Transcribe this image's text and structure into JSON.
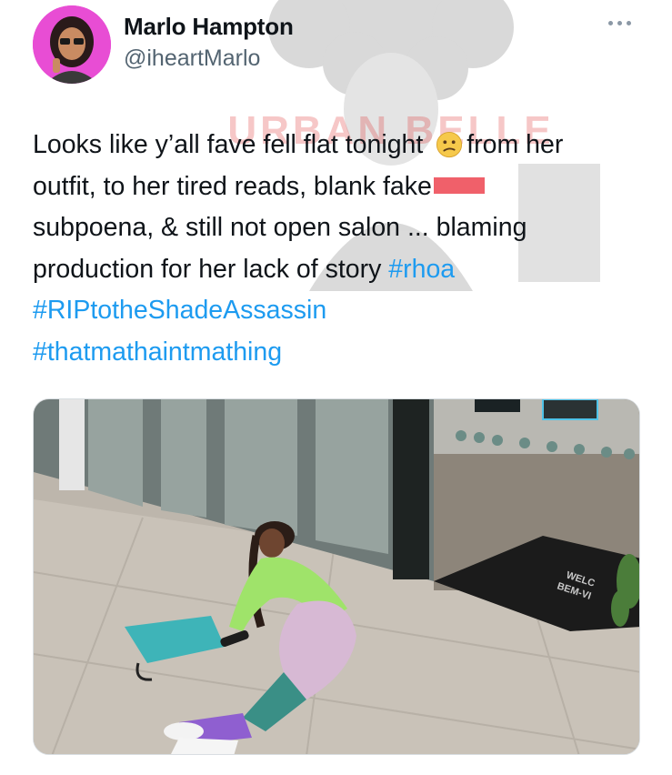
{
  "tweet": {
    "author_name": "Marlo Hampton",
    "author_handle": "@iheartMarlo",
    "watermark_text": "URBAN BELLE",
    "lines": [
      {
        "text": "Looks like y’all fave fell flat tonight ",
        "emoji": "confused-face",
        "after": "from her"
      },
      {
        "text": "outfit, to her tired reads, blank fake"
      },
      {
        "text": "subpoena, & still not open salon ... blaming"
      },
      {
        "text": "production for her lack of story ",
        "hashtag": "#rhoa"
      }
    ],
    "hashtags": [
      "#RIPtotheShadeAssassin",
      "#thatmathaintmathing"
    ]
  },
  "media": {
    "mat_text_line1": "WELC",
    "mat_text_line2": "BEM-VI"
  },
  "colors": {
    "link": "#1d9bf0",
    "text": "#0f1419",
    "muted": "#536471",
    "redaction": "#f0606a"
  }
}
